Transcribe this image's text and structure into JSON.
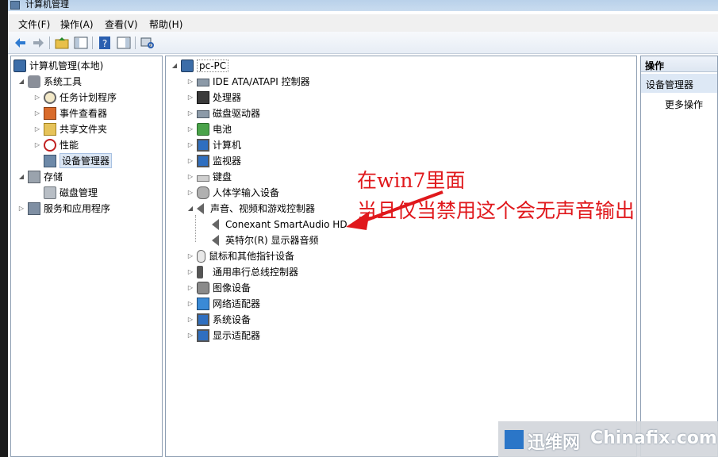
{
  "window": {
    "title": "计算机管理"
  },
  "menu": [
    "文件(F)",
    "操作(A)",
    "查看(V)",
    "帮助(H)"
  ],
  "left_tree": {
    "root": "计算机管理(本地)",
    "items": [
      {
        "label": "系统工具",
        "icon": "tools-icon"
      },
      {
        "label": "任务计划程序",
        "icon": "clock-icon"
      },
      {
        "label": "事件查看器",
        "icon": "event-log-icon"
      },
      {
        "label": "共享文件夹",
        "icon": "shared-folder-icon"
      },
      {
        "label": "性能",
        "icon": "performance-icon"
      },
      {
        "label": "设备管理器",
        "icon": "device-manager-icon"
      },
      {
        "label": "存储",
        "icon": "storage-icon"
      },
      {
        "label": "磁盘管理",
        "icon": "disk-icon"
      },
      {
        "label": "服务和应用程序",
        "icon": "services-icon"
      }
    ]
  },
  "device_tree": {
    "root": "pc-PC",
    "categories": [
      "IDE ATA/ATAPI 控制器",
      "处理器",
      "磁盘驱动器",
      "电池",
      "计算机",
      "监视器",
      "键盘",
      "人体学输入设备",
      "声音、视频和游戏控制器",
      "鼠标和其他指针设备",
      "通用串行总线控制器",
      "图像设备",
      "网络适配器",
      "系统设备",
      "显示适配器"
    ],
    "sound_children": [
      "Conexant SmartAudio HD",
      "英特尔(R) 显示器音频"
    ]
  },
  "actions": {
    "header": "操作",
    "section": "设备管理器",
    "more": "更多操作"
  },
  "annotation": {
    "line1": "在win7里面",
    "line2": "当且仅当禁用这个会无声音输出",
    "color": "#e0181c"
  },
  "watermark": {
    "brand": "迅维网",
    "site": "Chinafix.com"
  }
}
